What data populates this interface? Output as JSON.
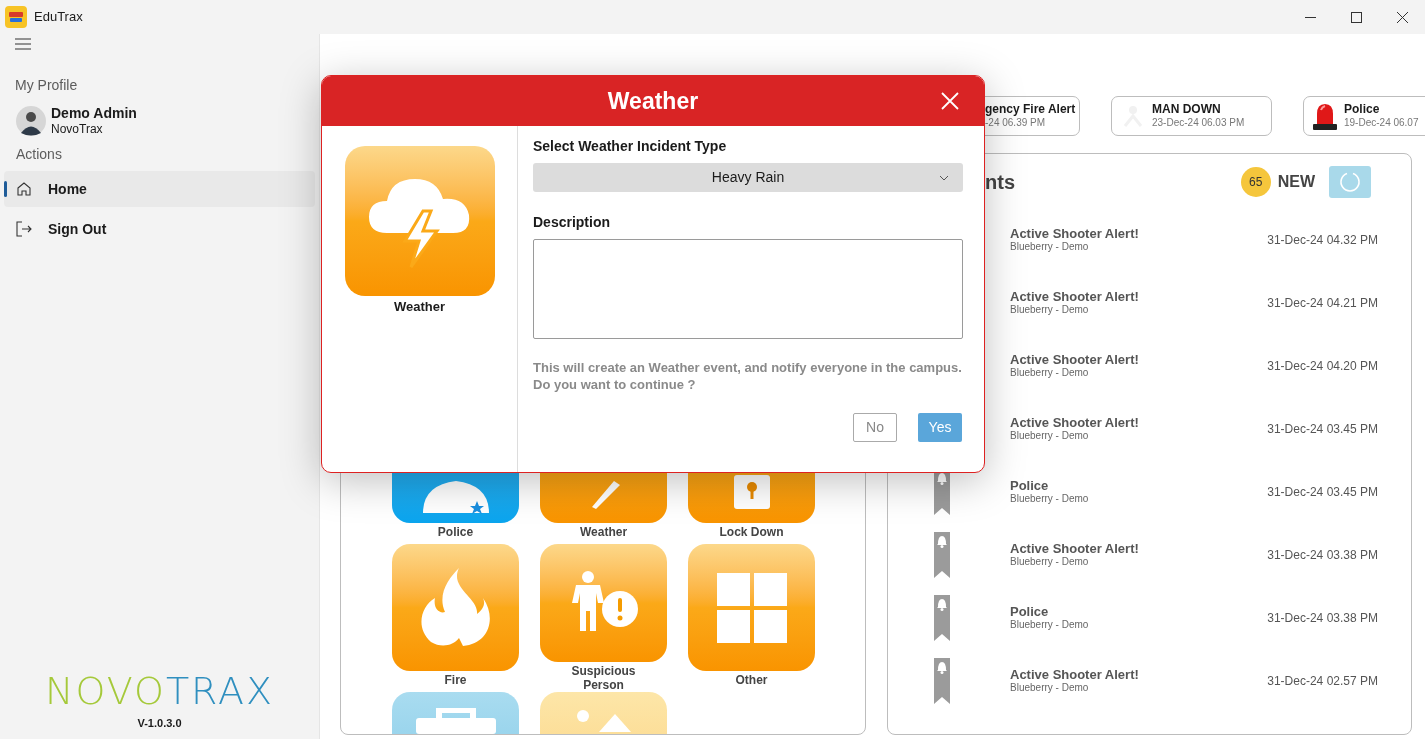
{
  "window": {
    "title": "EduTrax"
  },
  "sidebar": {
    "profile_heading": "My Profile",
    "user": {
      "name": "Demo Admin",
      "org": "NovoTrax"
    },
    "actions_heading": "Actions",
    "items": [
      {
        "label": "Home",
        "kind": "home",
        "selected": true
      },
      {
        "label": "Sign Out",
        "kind": "signout",
        "selected": false
      }
    ],
    "logo": {
      "part_1": "NOVO",
      "part_2": "TRAX"
    },
    "version": "V-1.0.3.0"
  },
  "open_incidents": [
    {
      "title": "gency Fire Alert",
      "time": "-24 06.39 PM",
      "kind": "plain"
    },
    {
      "title": "MAN DOWN",
      "time": "23-Dec-24 06.03 PM",
      "kind": "faint"
    },
    {
      "title": "Police",
      "time": "19-Dec-24 06.07",
      "kind": "siren"
    }
  ],
  "incident_types": [
    {
      "label": "Police",
      "kind": "police"
    },
    {
      "label": "Weather",
      "kind": "weather"
    },
    {
      "label": "Lock Down",
      "kind": "lock"
    },
    {
      "label": "Fire",
      "kind": "fire"
    },
    {
      "label": "Suspicious Person",
      "kind": "person"
    },
    {
      "label": "Other",
      "kind": "other"
    },
    {
      "kind": "kit"
    },
    {
      "kind": "image"
    }
  ],
  "recent": {
    "title": "nts",
    "count": "65",
    "new_label": "NEW",
    "rows": [
      {
        "title": "Active Shooter Alert!",
        "subtitle": "Blueberry - Demo",
        "time": "31-Dec-24 04.32 PM"
      },
      {
        "title": "Active Shooter Alert!",
        "subtitle": "Blueberry - Demo",
        "time": "31-Dec-24 04.21 PM"
      },
      {
        "title": "Active Shooter Alert!",
        "subtitle": "Blueberry - Demo",
        "time": "31-Dec-24 04.20 PM"
      },
      {
        "title": "Active Shooter Alert!",
        "subtitle": "Blueberry - Demo",
        "time": "31-Dec-24 03.45 PM"
      },
      {
        "title": "Police",
        "subtitle": "Blueberry - Demo",
        "time": "31-Dec-24 03.45 PM"
      },
      {
        "title": "Active Shooter Alert!",
        "subtitle": "Blueberry - Demo",
        "time": "31-Dec-24 03.38 PM"
      },
      {
        "title": "Police",
        "subtitle": "Blueberry - Demo",
        "time": "31-Dec-24 03.38 PM"
      },
      {
        "title": "Active Shooter Alert!",
        "subtitle": "Blueberry - Demo",
        "time": "31-Dec-24 02.57 PM"
      }
    ]
  },
  "dialog": {
    "title": "Weather",
    "tile_label": "Weather",
    "type_label": "Select Weather Incident Type",
    "type_value": "Heavy Rain",
    "description_label": "Description",
    "message": "This will create an Weather event, and notify everyone in the campus.\nDo you want to continue ?",
    "buttons": [
      {
        "label": "No",
        "kind": "secondary"
      },
      {
        "label": "Yes",
        "kind": "primary"
      }
    ]
  }
}
